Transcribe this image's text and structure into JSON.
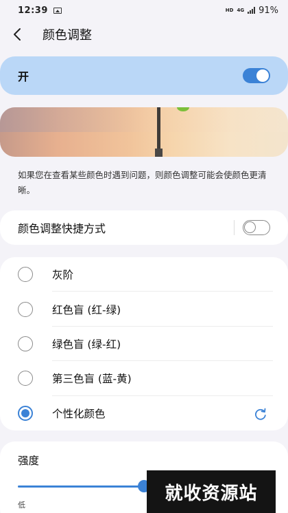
{
  "status_bar": {
    "time": "12:39",
    "hd_label": "HD",
    "network_label": "4G",
    "battery": "91%"
  },
  "header": {
    "title": "颜色调整"
  },
  "master_switch": {
    "label": "开",
    "state": "on"
  },
  "description": "如果您在查看某些颜色时遇到问题，则颜色调整可能会使颜色更清晰。",
  "shortcut": {
    "label": "颜色调整快捷方式",
    "state": "off"
  },
  "options": [
    {
      "label": "灰阶",
      "selected": false
    },
    {
      "label": "红色盲 (红-绿)",
      "selected": false
    },
    {
      "label": "绿色盲 (绿-红)",
      "selected": false
    },
    {
      "label": "第三色盲 (蓝-黄)",
      "selected": false
    },
    {
      "label": "个性化颜色",
      "selected": true
    }
  ],
  "intensity": {
    "title": "强度",
    "min_label": "低",
    "value_fraction": 0.5
  },
  "watermark": "就收资源站",
  "colors": {
    "accent": "#3b82d6",
    "switch_bar_bg": "#bad7f7",
    "page_bg": "#f4f3f8"
  }
}
